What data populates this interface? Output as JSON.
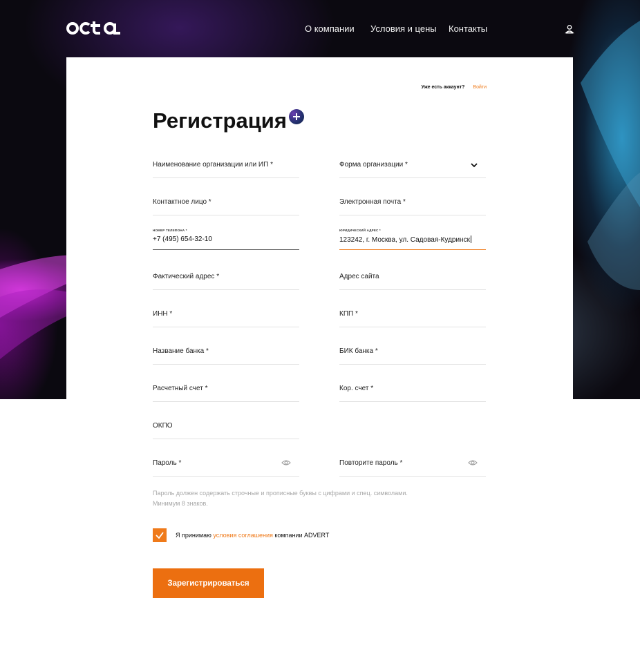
{
  "header": {
    "logo_text": "octa",
    "nav": [
      "О компании",
      "Условия и цены",
      "Контакты"
    ],
    "user_icon": "user-icon"
  },
  "auth": {
    "question": "Уже есть аккаунт?",
    "login_link": "Войти"
  },
  "form": {
    "title": "Регистрация",
    "add_icon": "plus-circle-icon",
    "fields": {
      "org_name": "Наименование организации или ИП *",
      "org_form": "Форма организации *",
      "contact": "Контактное лицо *",
      "email": "Электронная почта *",
      "phone_label": "НОМЕР ТЕЛЕФОНА *",
      "phone_value": "+7 (495) 654-32-10",
      "legal_label": "ЮРИДИЧЕСКИЙ АДРЕС *",
      "legal_value": "123242, г. Москва, ул. Садовая-Кудринск",
      "actual_address": "Фактический адрес *",
      "website": "Адрес сайта",
      "inn": "ИНН *",
      "kpp": "КПП *",
      "bank_name": "Название банка *",
      "bik": "БИК банка *",
      "account": "Расчетный счет *",
      "corr_account": "Кор. счет *",
      "okpo": "ОКПО",
      "password": "Пароль *",
      "password_repeat": "Повторите пароль *"
    },
    "hint_line1": "Пароль должен содержать строчные и прописные буквы с цифрами и спец. символами.",
    "hint_line2": "Минимум 8 знаков.",
    "agree_prefix": "Я принимаю",
    "agree_link": "условия соглашения",
    "agree_suffix": "компании ADVERT",
    "agree_checked": true,
    "submit": "Зарегистрироваться"
  },
  "colors": {
    "accent": "#ef7a1a",
    "button": "#ec6f10",
    "hero_bg": "#0b0910"
  }
}
